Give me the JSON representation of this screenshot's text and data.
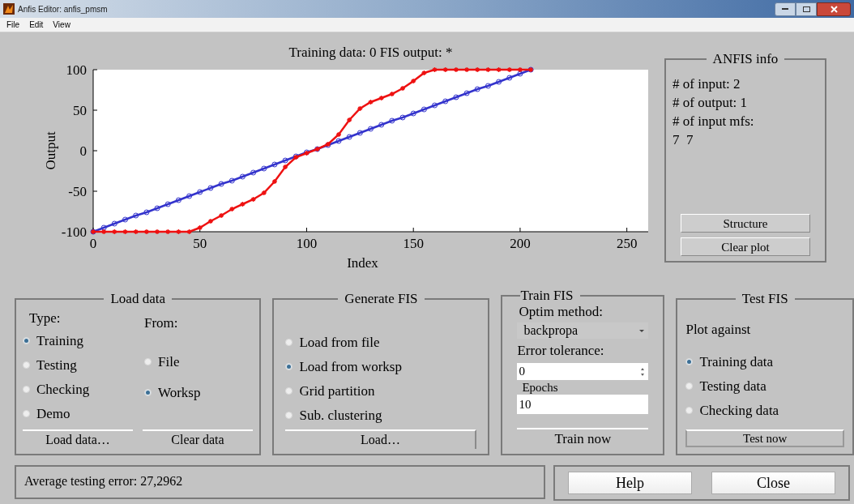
{
  "window": {
    "title": "Anfis Editor: anfis_pmsm"
  },
  "menu": [
    "File",
    "Edit",
    "View"
  ],
  "plot": {
    "chart_data": {
      "type": "line",
      "title": "Training data: 0 FIS output: *",
      "xlabel": "Index",
      "ylabel": "Output",
      "xlim": [
        0,
        260
      ],
      "ylim": [
        -100,
        100
      ],
      "xticks": [
        0,
        50,
        100,
        150,
        200,
        250
      ],
      "yticks": [
        -100,
        -50,
        0,
        50,
        100
      ],
      "x": [
        0,
        5,
        10,
        15,
        20,
        25,
        30,
        35,
        40,
        45,
        50,
        55,
        60,
        65,
        70,
        75,
        80,
        85,
        90,
        95,
        100,
        105,
        110,
        115,
        120,
        125,
        130,
        135,
        140,
        145,
        150,
        155,
        160,
        165,
        170,
        175,
        180,
        185,
        190,
        195,
        200,
        205
      ],
      "series": [
        {
          "color": "#3333cc",
          "values": [
            -100,
            -95,
            -90,
            -85,
            -80,
            -76,
            -71,
            -66,
            -61,
            -56,
            -51,
            -46,
            -41,
            -37,
            -32,
            -27,
            -22,
            -17,
            -12,
            -7,
            -2,
            2,
            7,
            12,
            17,
            22,
            27,
            32,
            37,
            41,
            46,
            51,
            56,
            61,
            66,
            71,
            76,
            80,
            85,
            90,
            95,
            100
          ]
        },
        {
          "color": "#ee1111",
          "values": [
            -100,
            -100,
            -100,
            -100,
            -100,
            -100,
            -100,
            -100,
            -100,
            -100,
            -95,
            -87,
            -80,
            -72,
            -66,
            -60,
            -52,
            -38,
            -20,
            -8,
            -3,
            2,
            8,
            20,
            38,
            52,
            60,
            65,
            70,
            77,
            86,
            96,
            100,
            100,
            100,
            100,
            100,
            100,
            100,
            100,
            100,
            100
          ]
        }
      ]
    }
  },
  "anfis_info": {
    "title": "ANFIS info",
    "lines": [
      "# of input: 2",
      "# of output: 1",
      "# of input mfs:",
      "7  7"
    ],
    "buttons": [
      "Structure",
      "Clear plot"
    ]
  },
  "load_data": {
    "title": "Load data",
    "type_label": "Type:",
    "from_label": "From:",
    "types": [
      {
        "label": "Training",
        "selected": true
      },
      {
        "label": "Testing",
        "selected": false
      },
      {
        "label": "Checking",
        "selected": false
      },
      {
        "label": "Demo",
        "selected": false
      }
    ],
    "sources": [
      {
        "label": "File",
        "selected": false
      },
      {
        "label": "Worksp",
        "selected": true
      }
    ],
    "buttons": [
      "Load data…",
      "Clear data"
    ]
  },
  "generate_fis": {
    "title": "Generate FIS",
    "options": [
      {
        "label": "Load from file",
        "selected": false
      },
      {
        "label": "Load from worksp",
        "selected": true
      },
      {
        "label": "Grid partition",
        "selected": false
      },
      {
        "label": "Sub. clustering",
        "selected": false
      }
    ],
    "button": "Load…"
  },
  "train_fis": {
    "title": "Train FIS",
    "method_label": "Optim method:",
    "method": "backpropa",
    "tolerance_label": "Error tolerance:",
    "tolerance": "0",
    "epochs_label": "Epochs",
    "epochs": "10",
    "button": "Train now"
  },
  "test_fis": {
    "title": "Test FIS",
    "label": "Plot against",
    "options": [
      {
        "label": "Training data",
        "selected": true
      },
      {
        "label": "Testing data",
        "selected": false
      },
      {
        "label": "Checking data",
        "selected": false
      }
    ],
    "button": "Test now"
  },
  "status": "Average testing error: 27,2962",
  "buttons": [
    "Help",
    "Close"
  ]
}
